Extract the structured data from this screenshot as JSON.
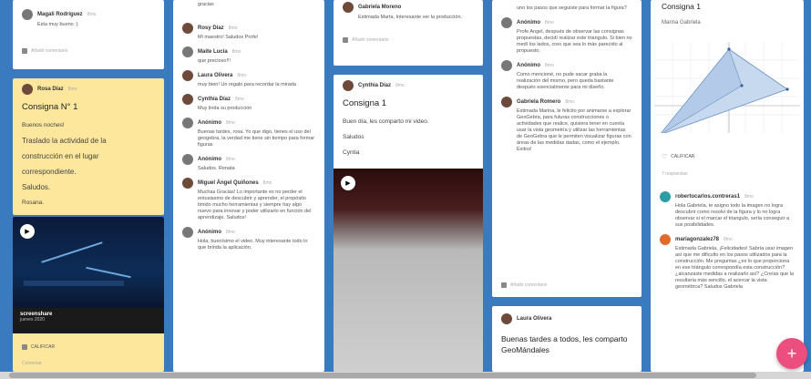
{
  "col1": {
    "card1": {
      "author": "Magali Rodríguez",
      "time": "8mo",
      "text": "Esta muy bueno :)",
      "comment_label": "Añadir comentario"
    },
    "card2": {
      "author": "Rosa Díaz",
      "time": "8mo",
      "title": "Consigna N° 1",
      "lines": [
        "Buenos noches!",
        "Traslado la actividad de la",
        "construcción en el lugar",
        "correspondiente.",
        "Saludos.",
        "Rosana."
      ]
    },
    "card3": {
      "caption": "screenshare",
      "subcaption": "jueves 2020",
      "action": "CALIFICAR",
      "comment_label": "Comentar"
    }
  },
  "col2": {
    "entries": [
      {
        "author": "",
        "time": "",
        "text": "gracias"
      },
      {
        "author": "Rosy Díaz",
        "time": "8mo",
        "text": "Mi maestro! Saludos Profe!"
      },
      {
        "author": "Maite Lucía",
        "time": "8mo",
        "text": "que precioso!!!"
      },
      {
        "author": "Laura Olivera",
        "time": "8mo",
        "text": "muy bien! Un regalo para recordar la mirada"
      },
      {
        "author": "Cynthia Díaz",
        "time": "8mo",
        "text": "Muy linda su producción"
      },
      {
        "author": "Anónimo",
        "time": "8mo",
        "text": "Buenas tardes, rosa. Yo que digo, tienes el uso del geogebra, la verdad me tiene sin tiempo para formar figuras"
      },
      {
        "author": "Anónimo",
        "time": "8mo",
        "text": "Saludos. Renata"
      },
      {
        "author": "Miguel Ángel Quiñones",
        "time": "8mo",
        "text": "Muchas Gracias! Lo importante es no perder el entusiasmo de descubrir y aprender, el propósito timido mucho herramientas y siempre hay algo nuevo para innovar y poder utilizarlo en función del aprendizaje. Saludos!"
      },
      {
        "author": "Anónimo",
        "time": "8mo",
        "text": "Hola, buenísimo el video. Muy interesante todo lo que brinda la aplicación."
      }
    ]
  },
  "col3": {
    "card1": {
      "author": "Gabriela Moreno",
      "time": "",
      "text": "Estimada Marta, Interesante ver la producción.",
      "comment_label": "Añadir comentario"
    },
    "card2": {
      "author": "Cynthia Díaz",
      "time": "8mo",
      "title": "Consigna 1",
      "lines": [
        "Buen día, les comparto mi video.",
        "Saludos",
        "Cyntia"
      ]
    }
  },
  "col4": {
    "entries": [
      {
        "author": "",
        "time": "",
        "text": "uno los pasos que seguiste para formar la figura?"
      },
      {
        "author": "Anónimo",
        "time": "8mo",
        "text": "Profe Angel, después de observar las consignas propuestas, decidí realizar este triangulo. Si bien no medí los lados, creo que sea lo más parecido al propuesto."
      },
      {
        "author": "Anónimo",
        "time": "8mo",
        "text": "Como mencioné, no pude sacar graba la realización del mismo, pero queda bastante después esencialmente para mi diseño."
      },
      {
        "author": "Gabriela Romero",
        "time": "8mo",
        "text": "Estimada Marina, le felicito por animarse a explorar GeoGebra, para futuras construcciones o actividades que realice, quisiera tener en cuenta usar la vista geometría y utilizar las herramientas de GeoGebra que le permiten visualizar figuras con áreas de las medidas dadas, como el ejemplo. Éxitos!"
      }
    ],
    "comment_label": "Añadir comentario",
    "card2": {
      "author": "Laura Olivera",
      "time": "",
      "title": "Buenas tardes a todos, les comparto GeoMándales"
    }
  },
  "col5": {
    "title": "Consigna 1",
    "subtitle": "Marina Gabriela",
    "action": "CALIFICAR",
    "comments_label": "7 respuestas",
    "entries": [
      {
        "author": "robertocarlos.contreras1",
        "time": "8mo",
        "text": "Hola Gabriela, te asigno todo la imagen no logra descubrir como resolvi de la figura y lo no logra observar si el marcar el triangulo, sería conseguir a sus posibilidades."
      },
      {
        "author": "mariagonzalez78",
        "time": "8mo",
        "text": "Estimada Gabriela, ¡Felicidades! Sabría usar imagen así que me dificulto en los pasos utilizados para la construcción. Me preguntas ¿es lo que proporciona en ese triángulo correspondía esta construcción? ¿alcanzaste medidas a realizarlo así? ¿Creías que la resultaría más sencillo, el acercar la vista geométrica? Saludos Gabriela"
      }
    ]
  },
  "fab_label": "+"
}
